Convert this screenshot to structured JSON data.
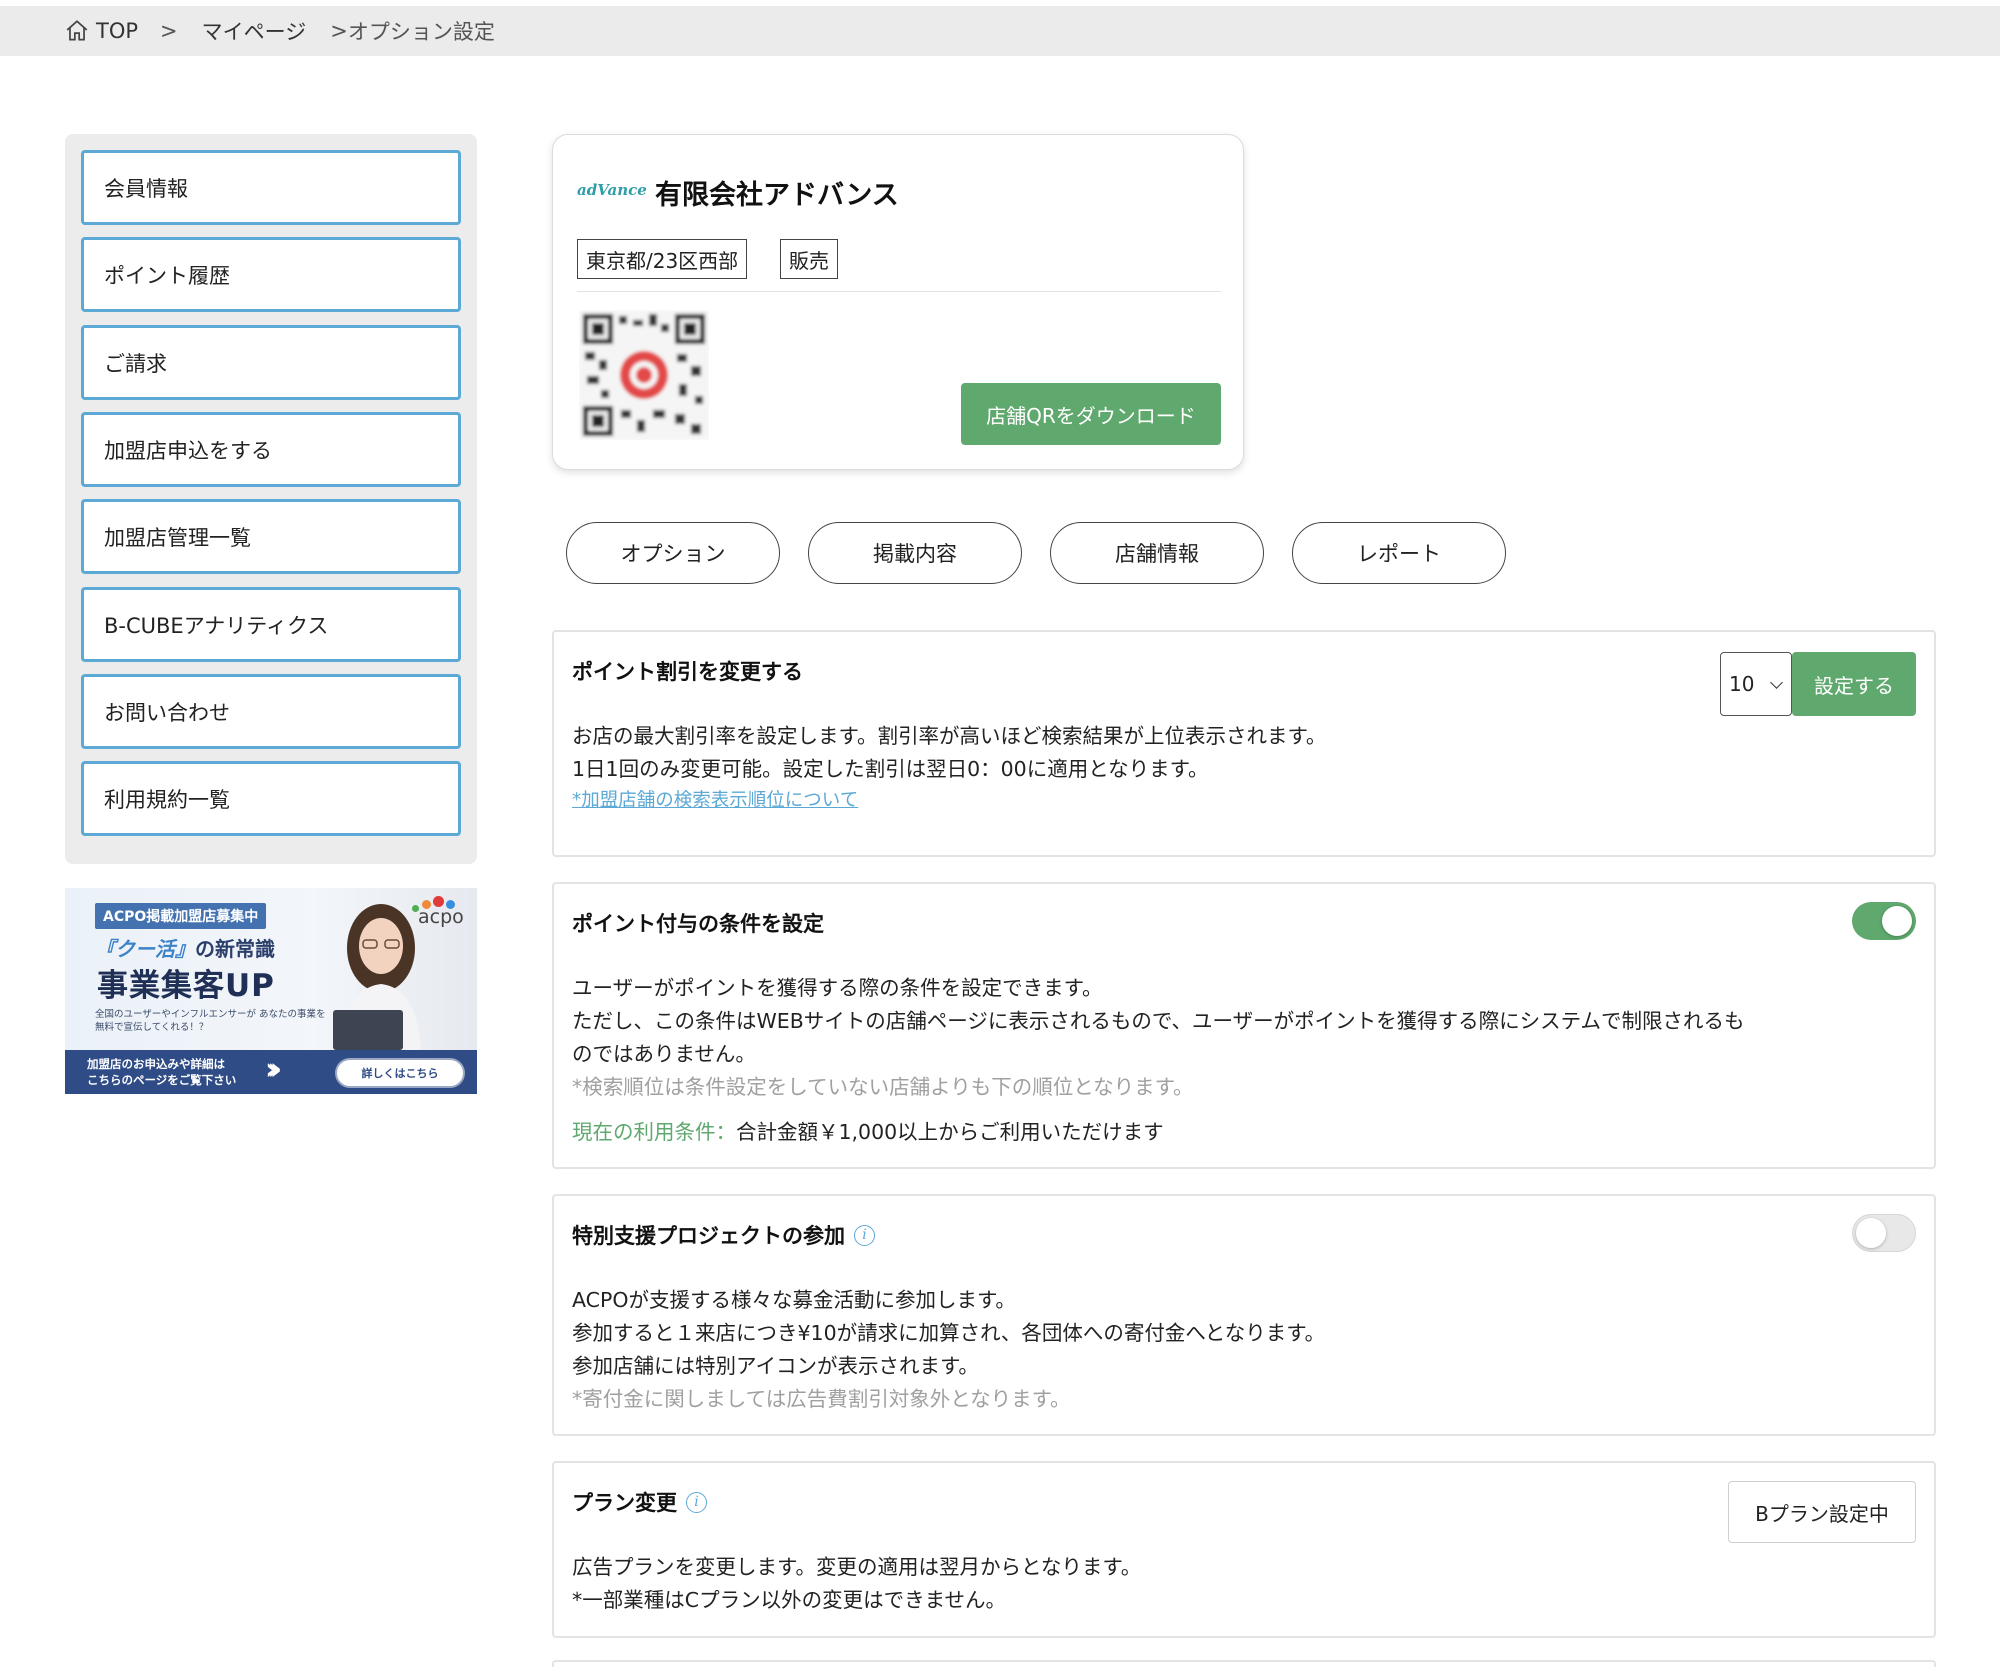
{
  "breadcrumb": {
    "items": [
      "TOP",
      "マイページ",
      "オプション設定"
    ],
    "sep": ">",
    "sep_current": ">"
  },
  "sidebar": {
    "items": [
      {
        "label": "会員情報"
      },
      {
        "label": "ポイント履歴"
      },
      {
        "label": "ご請求"
      },
      {
        "label": "加盟店申込をする"
      },
      {
        "label": "加盟店管理一覧"
      },
      {
        "label": "B-CUBEアナリティクス"
      },
      {
        "label": "お問い合わせ"
      },
      {
        "label": "利用規約一覧"
      }
    ]
  },
  "banner": {
    "tag": "ACPO掲載加盟店募集中",
    "line1_highlight": "『クー活』",
    "line1_rest": "の新常識",
    "line2": "事業集客UP",
    "line3": "全国のユーザーやインフルエンサーが あなたの事業を無料で宣伝してくれる！？",
    "footer_line1": "加盟店のお申込みや詳細は",
    "footer_line2": "こちらのページをご覧下さい",
    "arrows": "›››",
    "more": "詳しくはこちら",
    "logo": "acpo"
  },
  "store": {
    "logo_text": "adVance",
    "name": "有限会社アドバンス",
    "tags": [
      "東京都/23区西部",
      "販売"
    ],
    "qr_button": "店舗QRをダウンロード"
  },
  "tabs": [
    "オプション",
    "掲載内容",
    "店舗情報",
    "レポート"
  ],
  "panels": {
    "discount": {
      "title": "ポイント割引を変更する",
      "select_value": "10",
      "button": "設定する",
      "line1": "お店の最大割引率を設定します。割引率が高いほど検索結果が上位表示されます。",
      "line2": "1日1回のみ変更可能。設定した割引は翌日0：00に適用となります。",
      "link": "*加盟店舗の検索表示順位について"
    },
    "condition": {
      "title": "ポイント付与の条件を設定",
      "toggle": "on",
      "line1": "ユーザーがポイントを獲得する際の条件を設定できます。",
      "line2": "ただし、この条件はWEBサイトの店舗ページに表示されるもので、ユーザーがポイントを獲得する際にシステムで制限されるも",
      "line3": "のではありません。",
      "note": "*検索順位は条件設定をしていない店舗よりも下の順位となります。",
      "current_label": "現在の利用条件：",
      "current_value": "合計金額￥1,000以上からご利用いただけます"
    },
    "support": {
      "title": "特別支援プロジェクトの参加",
      "toggle": "off",
      "line1": "ACPOが支援する様々な募金活動に参加します。",
      "line2": "参加すると１来店につき¥10が請求に加算され、各団体への寄付金へとなります。",
      "line3": "参加店舗には特別アイコンが表示されます。",
      "note": "*寄付金に関しましては広告費割引対象外となります。"
    },
    "plan": {
      "title": "プラン変更",
      "button": "Bプラン設定中",
      "line1": "広告プランを変更します。変更の適用は翌月からとなります。",
      "line2": "*一部業種はCプラン以外の変更はできません。"
    }
  },
  "colors": {
    "accent_blue": "#5da9d6",
    "accent_green": "#5fa86e",
    "note_gray": "#a0a0a0"
  }
}
